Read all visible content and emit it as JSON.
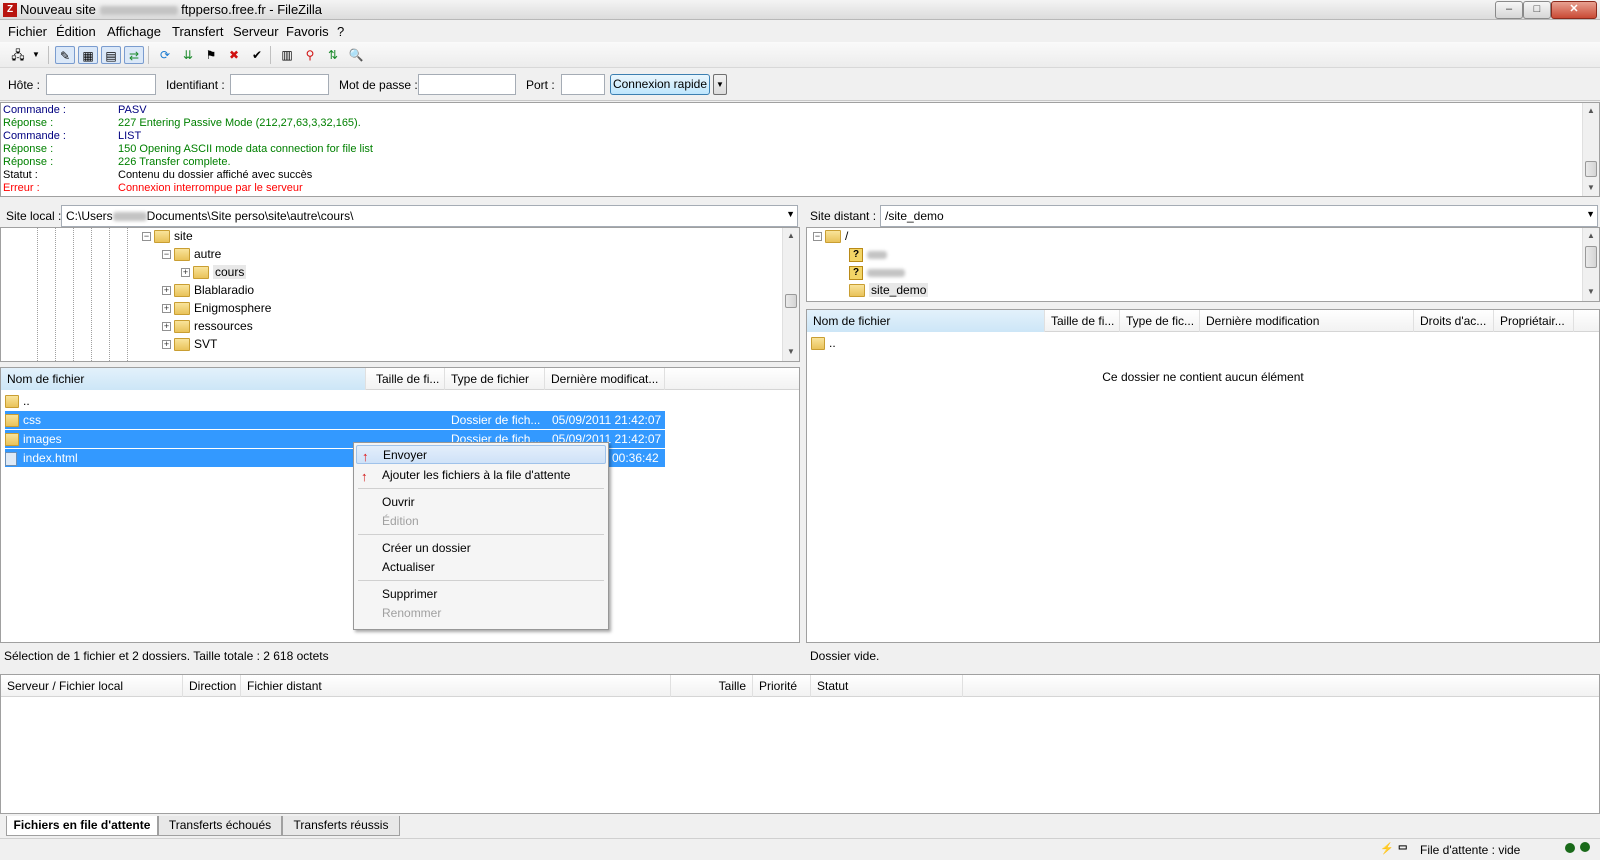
{
  "window": {
    "title_prefix": "Nouveau site",
    "title_suffix": "ftpperso.free.fr - FileZilla",
    "app_icon": "Z",
    "controls": {
      "minimize": "–",
      "maximize": "□",
      "close": "✕"
    }
  },
  "menu": [
    "Fichier",
    "Édition",
    "Affichage",
    "Transfert",
    "Serveur",
    "Favoris",
    "?"
  ],
  "toolbar": {
    "icons": [
      "site-manager-icon",
      "dropdown-arrow-icon",
      "toggle-log-icon",
      "toggle-local-tree-icon",
      "toggle-remote-tree-icon",
      "toggle-queue-icon",
      "refresh-icon",
      "process-queue-icon",
      "cancel-icon",
      "disconnect-icon",
      "reconnect-icon",
      "filter-icon",
      "compare-icon",
      "sync-browse-icon",
      "search-icon"
    ]
  },
  "quickconnect": {
    "host_label": "Hôte :",
    "host_value": "",
    "user_label": "Identifiant :",
    "user_value": "",
    "pass_label": "Mot de passe :",
    "pass_value": "",
    "port_label": "Port :",
    "port_value": "",
    "button": "Connexion rapide",
    "dropdown": "▼"
  },
  "log": [
    {
      "type": "cmd",
      "label": "Commande :",
      "text": "PASV"
    },
    {
      "type": "resp",
      "label": "Réponse :",
      "text": "227 Entering Passive Mode (212,27,63,3,32,165)."
    },
    {
      "type": "cmd",
      "label": "Commande :",
      "text": "LIST"
    },
    {
      "type": "resp",
      "label": "Réponse :",
      "text": "150 Opening ASCII mode data connection for file list"
    },
    {
      "type": "resp",
      "label": "Réponse :",
      "text": "226 Transfer complete."
    },
    {
      "type": "stat",
      "label": "Statut :",
      "text": "Contenu du dossier affiché avec succès"
    },
    {
      "type": "err",
      "label": "Erreur :",
      "text": "Connexion interrompue par le serveur"
    }
  ],
  "local": {
    "path_label": "Site local :",
    "path_prefix": "C:\\Users",
    "path_suffix": "Documents\\Site perso\\site\\autre\\cours\\",
    "tree": [
      {
        "name": "site",
        "toggle": "−",
        "level": 0
      },
      {
        "name": "autre",
        "toggle": "−",
        "level": 1
      },
      {
        "name": "cours",
        "toggle": "+",
        "level": 2
      },
      {
        "name": "Blablaradio",
        "toggle": "+",
        "level": 1
      },
      {
        "name": "Enigmosphere",
        "toggle": "+",
        "level": 1
      },
      {
        "name": "ressources",
        "toggle": "+",
        "level": 1
      },
      {
        "name": "SVT",
        "toggle": "+",
        "level": 1
      }
    ],
    "columns": [
      "Nom de fichier",
      "Taille de fi...",
      "Type de fichier",
      "Dernière modificat..."
    ],
    "rows": [
      {
        "name": "..",
        "size": "",
        "type": "",
        "modified": "",
        "icon": "folder",
        "selected": false
      },
      {
        "name": "css",
        "size": "",
        "type": "Dossier de fich...",
        "modified": "05/09/2011 21:42:07",
        "icon": "folder",
        "selected": true
      },
      {
        "name": "images",
        "size": "",
        "type": "Dossier de fich...",
        "modified": "05/09/2011 21:42:07",
        "icon": "folder",
        "selected": true
      },
      {
        "name": "index.html",
        "size": "",
        "type": "",
        "modified": "00:36:42",
        "icon": "file",
        "selected": true
      }
    ],
    "status": "Sélection de 1 fichier et 2 dossiers. Taille totale : 2 618 octets"
  },
  "context_menu": {
    "items": [
      {
        "label": "Envoyer",
        "icon": "upload-icon",
        "highlighted": true,
        "disabled": false
      },
      {
        "label": "Ajouter les fichiers à la file d'attente",
        "icon": "add-to-queue-icon",
        "highlighted": false,
        "disabled": false
      },
      {
        "label": "Ouvrir",
        "highlighted": false,
        "disabled": false
      },
      {
        "label": "Édition",
        "highlighted": false,
        "disabled": true
      },
      {
        "label": "Créer un dossier",
        "highlighted": false,
        "disabled": false
      },
      {
        "label": "Actualiser",
        "highlighted": false,
        "disabled": false
      },
      {
        "label": "Supprimer",
        "highlighted": false,
        "disabled": false
      },
      {
        "label": "Renommer",
        "highlighted": false,
        "disabled": true
      }
    ]
  },
  "remote": {
    "path_label": "Site distant :",
    "path_value": "/site_demo",
    "tree": [
      {
        "name": "/",
        "toggle": "−",
        "icon": "folder"
      },
      {
        "name": "",
        "icon": "unknown"
      },
      {
        "name": "",
        "icon": "unknown"
      },
      {
        "name": "site_demo",
        "icon": "folder"
      }
    ],
    "columns": [
      "Nom de fichier",
      "Taille de fi...",
      "Type de fic...",
      "Dernière modification",
      "Droits d'ac...",
      "Propriétair..."
    ],
    "rows": [
      {
        "name": "..",
        "icon": "folder"
      }
    ],
    "empty_message": "Ce dossier ne contient aucun élément",
    "status": "Dossier vide."
  },
  "queue": {
    "columns": [
      "Serveur / Fichier local",
      "Direction",
      "Fichier distant",
      "Taille",
      "Priorité",
      "Statut"
    ]
  },
  "queue_tabs": [
    "Fichiers en file d'attente",
    "Transferts échoués",
    "Transferts réussis"
  ],
  "statusbar": {
    "queue_text": "File d'attente : vide"
  },
  "colors": {
    "selection": "#3399ff",
    "log_cmd": "#000080",
    "log_resp": "#008000",
    "log_err": "#ff0000"
  }
}
